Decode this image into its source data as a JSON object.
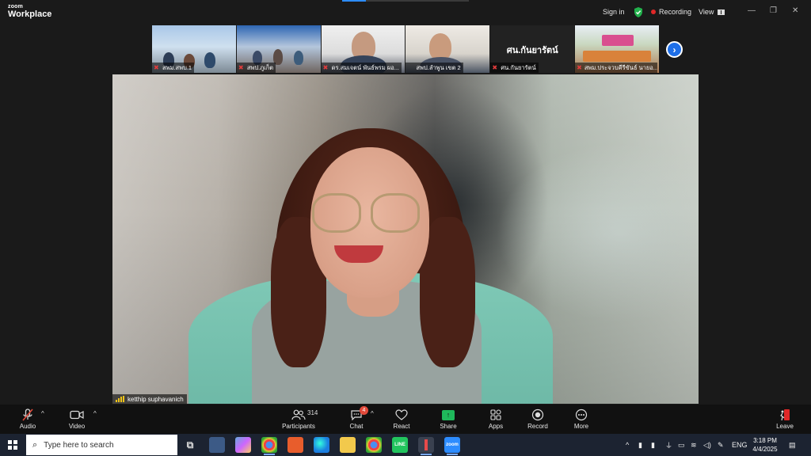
{
  "app": {
    "logo_small": "zoom",
    "logo_big": "Workplace",
    "sign_in": "Sign in",
    "recording": "Recording",
    "view": "View"
  },
  "gallery": {
    "tiles": [
      {
        "name": "สพม.สพบ.1"
      },
      {
        "name": "สพป.ภูเก็ต"
      },
      {
        "name": "ดร.สมเจตน์ พันธ์พรม ผอ..."
      },
      {
        "name": "สพป.ลำพูน เขต 2"
      },
      {
        "name": "ศน.กันยารัตน์",
        "center_label": "ศน.กันยารัตน์"
      },
      {
        "name": "สพม.ประจวบคีรีขันธ์ นายอ..."
      }
    ],
    "next_label": "›"
  },
  "main_video": {
    "participant": "ketthip suphavanich"
  },
  "toolbar": {
    "audio": "Audio",
    "video": "Video",
    "participants": "Participants",
    "participants_count": "314",
    "chat": "Chat",
    "chat_badge": "4",
    "react": "React",
    "share": "Share",
    "apps": "Apps",
    "record": "Record",
    "more": "More",
    "leave": "Leave"
  },
  "taskbar": {
    "search_placeholder": "Type here to search",
    "lang": "ENG",
    "time": "3:18 PM",
    "date": "4/4/2025",
    "zoom_app_label": "zoom"
  },
  "colors": {
    "accent": "#2d8cff",
    "share_green": "#1fb85b",
    "badge_red": "#e24a3b",
    "leave_red": "#e02828"
  }
}
